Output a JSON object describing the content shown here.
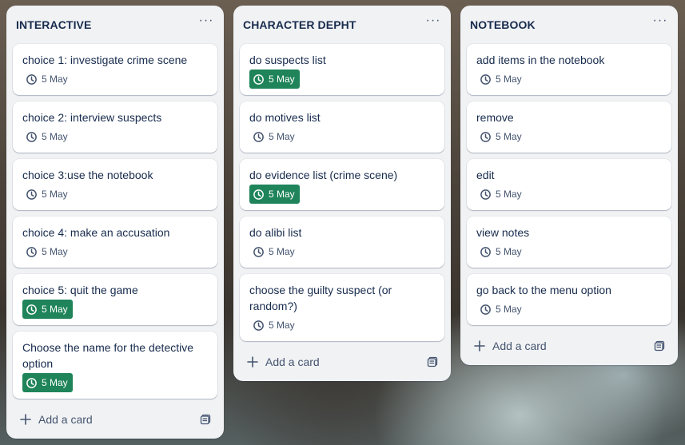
{
  "lists": [
    {
      "title": "INTERACTIVE",
      "add_label": "Add a card",
      "cards": [
        {
          "title": "choice 1: investigate crime scene",
          "date": "5 May",
          "due_highlight": false
        },
        {
          "title": "choice 2: interview suspects",
          "date": "5 May",
          "due_highlight": false
        },
        {
          "title": "choice 3:use the notebook",
          "date": "5 May",
          "due_highlight": false
        },
        {
          "title": "choice 4: make an accusation",
          "date": "5 May",
          "due_highlight": false
        },
        {
          "title": "choice 5: quit the game",
          "date": "5 May",
          "due_highlight": true
        },
        {
          "title": "Choose the name for the detective option",
          "date": "5 May",
          "due_highlight": true
        }
      ]
    },
    {
      "title": "CHARACTER DEPHT",
      "add_label": "Add a card",
      "cards": [
        {
          "title": "do suspects list",
          "date": "5 May",
          "due_highlight": true
        },
        {
          "title": "do motives list",
          "date": "5 May",
          "due_highlight": false
        },
        {
          "title": "do evidence list (crime scene)",
          "date": "5 May",
          "due_highlight": true
        },
        {
          "title": "do alibi list",
          "date": "5 May",
          "due_highlight": false
        },
        {
          "title": "choose the guilty suspect (or random?)",
          "date": "5 May",
          "due_highlight": false
        }
      ]
    },
    {
      "title": "NOTEBOOK",
      "add_label": "Add a card",
      "cards": [
        {
          "title": "add items in the notebook",
          "date": "5 May",
          "due_highlight": false
        },
        {
          "title": "remove",
          "date": "5 May",
          "due_highlight": false
        },
        {
          "title": "edit",
          "date": "5 May",
          "due_highlight": false
        },
        {
          "title": "view notes",
          "date": "5 May",
          "due_highlight": false
        },
        {
          "title": "go back to the menu option",
          "date": "5 May",
          "due_highlight": false
        }
      ]
    }
  ],
  "icons": {
    "list_menu": "more-horizontal-icon",
    "due_date": "clock-icon",
    "add": "plus-icon",
    "template": "card-template-icon"
  },
  "colors": {
    "list_bg": "#f1f2f4",
    "card_bg": "#ffffff",
    "text": "#172b4d",
    "muted": "#44546f",
    "due_green": "#1f845a"
  }
}
